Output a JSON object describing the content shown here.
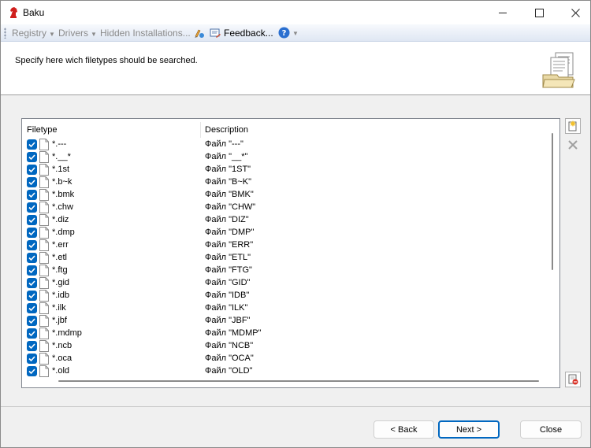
{
  "window": {
    "title": "Baku",
    "minimize_icon": "minimize-icon",
    "maximize_icon": "maximize-icon",
    "close_icon": "close-icon"
  },
  "toolbar": {
    "items": [
      {
        "label": "Registry",
        "has_dropdown": true,
        "enabled": false
      },
      {
        "label": "Drivers",
        "has_dropdown": true,
        "enabled": false
      },
      {
        "label": "Hidden Installations...",
        "has_dropdown": false,
        "enabled": false
      },
      {
        "label": "Feedback...",
        "has_dropdown": false,
        "enabled": true
      }
    ],
    "icons": [
      "paint-icon",
      "feedback-icon",
      "help-icon"
    ]
  },
  "header": {
    "text": "Specify here wich filetypes should be searched.",
    "art_icon": "documents-icon"
  },
  "list": {
    "columns": [
      "Filetype",
      "Description"
    ],
    "rows": [
      {
        "filetype": "*.---",
        "description": "Файл \"---\"",
        "checked": true
      },
      {
        "filetype": "*.__*",
        "description": "Файл \"__*\"",
        "checked": true
      },
      {
        "filetype": "*.1st",
        "description": "Файл \"1ST\"",
        "checked": true
      },
      {
        "filetype": "*.b~k",
        "description": "Файл \"B~K\"",
        "checked": true
      },
      {
        "filetype": "*.bmk",
        "description": "Файл \"BMK\"",
        "checked": true
      },
      {
        "filetype": "*.chw",
        "description": "Файл \"CHW\"",
        "checked": true
      },
      {
        "filetype": "*.diz",
        "description": "Файл \"DIZ\"",
        "checked": true
      },
      {
        "filetype": "*.dmp",
        "description": "Файл \"DMP\"",
        "checked": true
      },
      {
        "filetype": "*.err",
        "description": "Файл \"ERR\"",
        "checked": true
      },
      {
        "filetype": "*.etl",
        "description": "Файл \"ETL\"",
        "checked": true
      },
      {
        "filetype": "*.ftg",
        "description": "Файл \"FTG\"",
        "checked": true
      },
      {
        "filetype": "*.gid",
        "description": "Файл \"GID\"",
        "checked": true
      },
      {
        "filetype": "*.idb",
        "description": "Файл \"IDB\"",
        "checked": true
      },
      {
        "filetype": "*.ilk",
        "description": "Файл \"ILK\"",
        "checked": true
      },
      {
        "filetype": "*.jbf",
        "description": "Файл \"JBF\"",
        "checked": true
      },
      {
        "filetype": "*.mdmp",
        "description": "Файл \"MDMP\"",
        "checked": true
      },
      {
        "filetype": "*.ncb",
        "description": "Файл \"NCB\"",
        "checked": true
      },
      {
        "filetype": "*.oca",
        "description": "Файл \"OCA\"",
        "checked": true
      },
      {
        "filetype": "*.old",
        "description": "Файл \"OLD\"",
        "checked": true
      }
    ]
  },
  "side_buttons": {
    "add_icon": "new-document-icon",
    "delete_icon": "delete-x-icon",
    "import_icon": "import-document-icon"
  },
  "buttons": {
    "back": "< Back",
    "next": "Next >",
    "close": "Close"
  },
  "colors": {
    "accent": "#0067c0"
  }
}
